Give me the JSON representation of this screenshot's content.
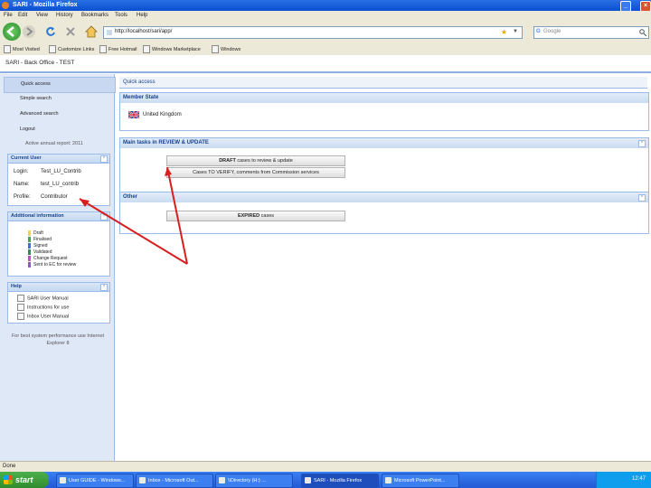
{
  "window": {
    "title": "SARI - Mozilla Firefox"
  },
  "menu": [
    "File",
    "Edit",
    "View",
    "History",
    "Bookmarks",
    "Tools",
    "Help"
  ],
  "nav": {
    "url": "http://localhost/sari/app/",
    "search_placeholder": "Google"
  },
  "bookmarks": [
    "Most Visited",
    "Customize Links",
    "Free Hotmail",
    "Windows Marketplace",
    "Windows"
  ],
  "app": {
    "title": "SARI - Back Office - TEST"
  },
  "sidebar": {
    "nav_items": [
      "Quick access",
      "Simple search",
      "Advanced search",
      "Logout"
    ],
    "active_report": "Active annual report: 2011",
    "current_user": {
      "title": "Current User",
      "rows": [
        {
          "label": "Login:",
          "value": "Test_LU_Contrib"
        },
        {
          "label": "Name:",
          "value": "test_LU_contrib"
        },
        {
          "label": "Profile:",
          "value": "Contributor"
        }
      ]
    },
    "additional_info": {
      "title": "Additional information",
      "legend": [
        {
          "label": "Draft",
          "color": "#e8d84a"
        },
        {
          "label": "Finalised",
          "color": "#44aa44"
        },
        {
          "label": "Signed",
          "color": "#3b6fd8"
        },
        {
          "label": "Validated",
          "color": "#2e8b57"
        },
        {
          "label": "Change Request",
          "color": "#c050c0"
        },
        {
          "label": "Sent to EC for review",
          "color": "#8855cc"
        }
      ]
    },
    "help": {
      "title": "Help",
      "items": [
        "SARI User Manual",
        "Instructions for use",
        "Inbox User Manual"
      ]
    },
    "footer_note": "For best system performance use Internet Explorer 8"
  },
  "main": {
    "quick_access_title": "Quick access",
    "member_state": {
      "title": "Member State",
      "country": "United Kingdom"
    },
    "main_tasks": {
      "title": "Main tasks in REVIEW & UPDATE",
      "buttons": [
        {
          "strong": "DRAFT",
          "rest": "cases to review & update"
        },
        {
          "strong": "",
          "rest": "Cases TO VERIFY, comments from Commission services"
        }
      ]
    },
    "other": {
      "title": "Other",
      "buttons": [
        {
          "strong": "EXPIRED",
          "rest": "cases"
        }
      ]
    }
  },
  "status": {
    "text": "Done"
  },
  "taskbar": {
    "start": "start",
    "tasks": [
      "User GUIDE - Windows...",
      "Inbox - Microsoft Out...",
      "\\\\Directory (H:) ...",
      "SARI - Mozilla Firefox",
      "Microsoft PowerPoint..."
    ],
    "clock": "12:47"
  },
  "colors": {
    "annotation_arrow": "#d81f1f",
    "accent": "#15428b"
  }
}
